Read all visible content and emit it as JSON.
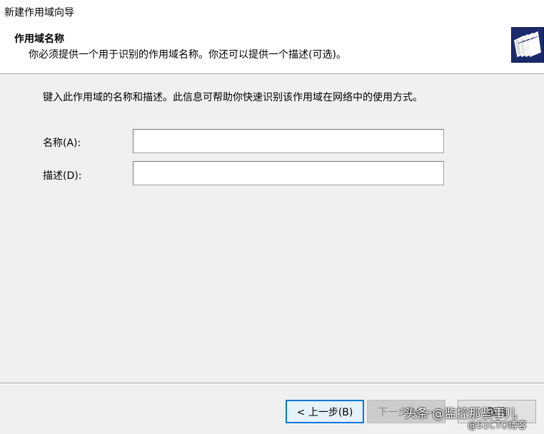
{
  "window": {
    "title": "新建作用域向导"
  },
  "header": {
    "heading": "作用域名称",
    "subheading": "你必须提供一个用于识别的作用域名称。你还可以提供一个描述(可选)。",
    "icon": "folders-wizard-icon"
  },
  "main": {
    "intro": "键入此作用域的名称和描述。此信息可帮助你快速识别该作用域在网络中的使用方式。",
    "name_label": "名称(A):",
    "name_value": "",
    "description_label": "描述(D):",
    "description_value": ""
  },
  "footer": {
    "back_label": "< 上一步(B)",
    "next_label": "下一步(N) >",
    "cancel_label": "取消"
  },
  "watermark": {
    "line1": "头条 @监控那些事儿",
    "line2": "@51CTO博客"
  }
}
